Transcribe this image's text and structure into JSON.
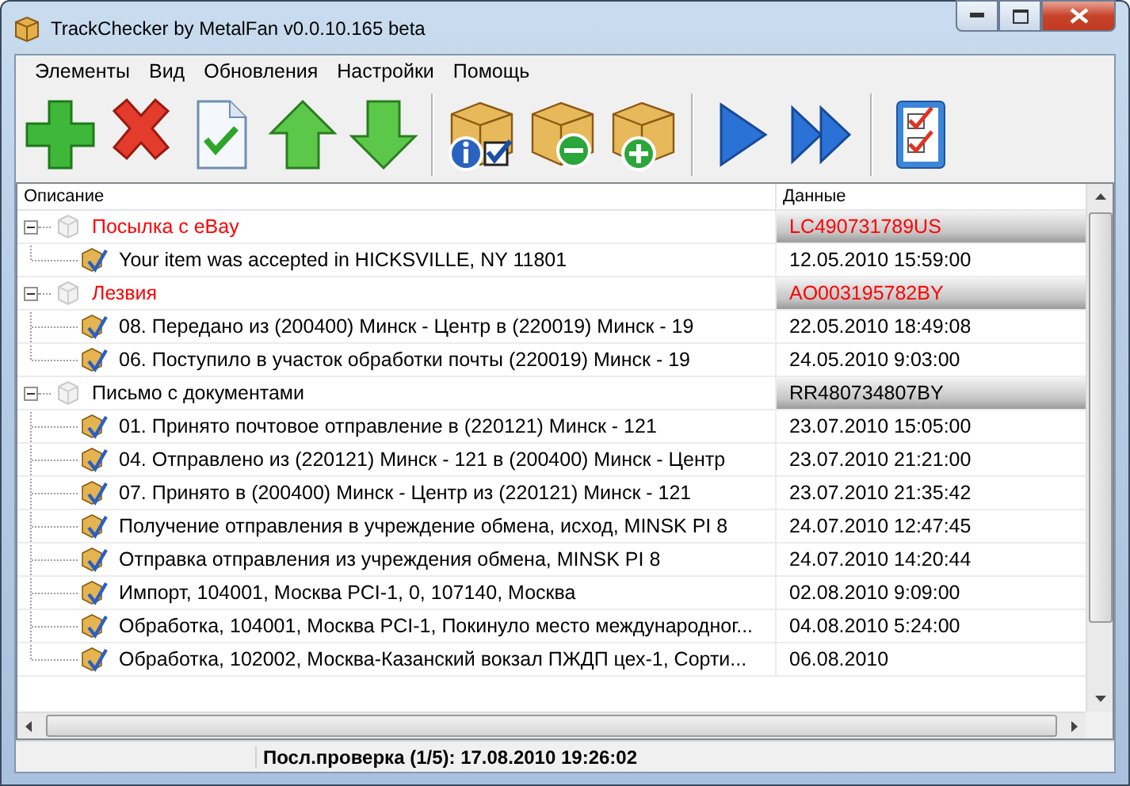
{
  "window": {
    "title": "TrackChecker by MetalFan v0.0.10.165 beta"
  },
  "menu": [
    "Элементы",
    "Вид",
    "Обновления",
    "Настройки",
    "Помощь"
  ],
  "table": {
    "columns": [
      "Описание",
      "Данные"
    ],
    "parcels": [
      {
        "name": "Посылка с eBay",
        "track": "LC490731789US",
        "color": "#ff0000",
        "expanded": true,
        "children": [
          {
            "description": "Your item was accepted in HICKSVILLE, NY 11801",
            "date": "12.05.2010 15:59:00"
          }
        ]
      },
      {
        "name": "Лезвия",
        "track": "AO003195782BY",
        "color": "#ff0000",
        "expanded": true,
        "children": [
          {
            "description": "08. Передано из (200400) Минск - Центр в (220019) Минск - 19",
            "date": "22.05.2010 18:49:08"
          },
          {
            "description": "06. Поступило в участок обработки почты (220019) Минск - 19",
            "date": "24.05.2010 9:03:00"
          }
        ]
      },
      {
        "name": "Письмо с документами",
        "track": "RR480734807BY",
        "color": "#000000",
        "expanded": true,
        "children": [
          {
            "description": "01. Принято почтовое отправление в (220121) Минск - 121",
            "date": "23.07.2010 15:05:00"
          },
          {
            "description": "04. Отправлено из (220121) Минск - 121 в (200400) Минск - Центр",
            "date": "23.07.2010 21:21:00"
          },
          {
            "description": "07. Принято в (200400) Минск - Центр из (220121) Минск - 121",
            "date": "23.07.2010 21:35:42"
          },
          {
            "description": "Получение отправления в учреждение обмена, исход, MINSK PI 8",
            "date": "24.07.2010 12:47:45"
          },
          {
            "description": "Отправка отправления из учреждения обмена, MINSK PI 8",
            "date": "24.07.2010 14:20:44"
          },
          {
            "description": "Импорт, 104001, Москва PCI-1, 0, 107140, Москва",
            "date": "02.08.2010 9:09:00"
          },
          {
            "description": "Обработка, 104001, Москва PCI-1, Покинуло место международног...",
            "date": "04.08.2010 5:24:00"
          },
          {
            "description": "Обработка, 102002, Москва-Казанский вокзал ПЖДП цех-1, Сорти...",
            "date": "06.08.2010"
          }
        ]
      }
    ]
  },
  "status_bar": {
    "text": "Посл.проверка (1/5): 17.08.2010 19:26:02"
  }
}
